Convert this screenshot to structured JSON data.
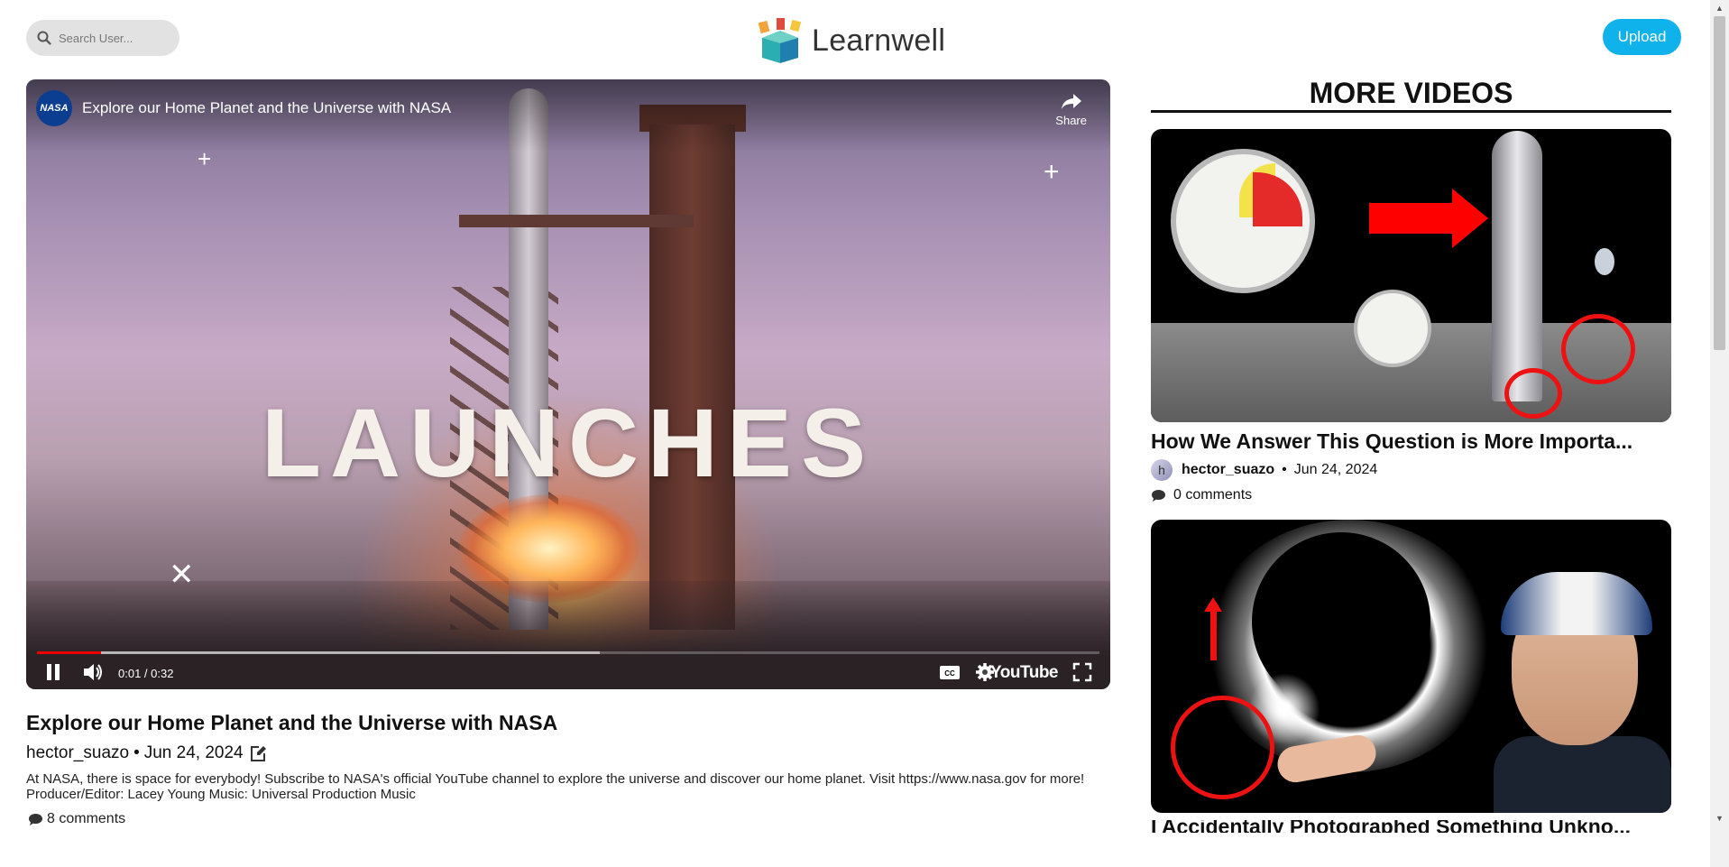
{
  "header": {
    "search_placeholder": "Search User...",
    "logo_text": "Learnwell",
    "upload_label": "Upload"
  },
  "player": {
    "channel_logo_text": "NASA",
    "title": "Explore our Home Planet and the Universe with NASA",
    "share_label": "Share",
    "overlay_text": "LAUNCHES",
    "time": "0:01 / 0:32",
    "progress_played": 0.06,
    "progress_buffered": 0.53,
    "youtube_label": "YouTube"
  },
  "video": {
    "title": "Explore our Home Planet and the Universe with NASA",
    "author": "hector_suazo",
    "separator": "•",
    "date": "Jun 24, 2024",
    "description": "At NASA, there is space for everybody! Subscribe to NASA's official YouTube channel to explore the universe and discover our home planet. Visit https://www.nasa.gov for more! Producer/Editor: Lacey Young Music: Universal Production Music",
    "comments": "8 comments"
  },
  "sidebar": {
    "heading": "MORE VIDEOS",
    "cards": [
      {
        "title": "How We Answer This Question is More Importa...",
        "avatar_letter": "h",
        "author": "hector_suazo",
        "separator": "•",
        "date": "Jun 24, 2024",
        "comments": "0 comments"
      },
      {
        "title": "I Accidentally Photographed Something Unkno..."
      }
    ]
  },
  "colors": {
    "accent": "#0fb2ea",
    "progress": "#ee0000"
  }
}
